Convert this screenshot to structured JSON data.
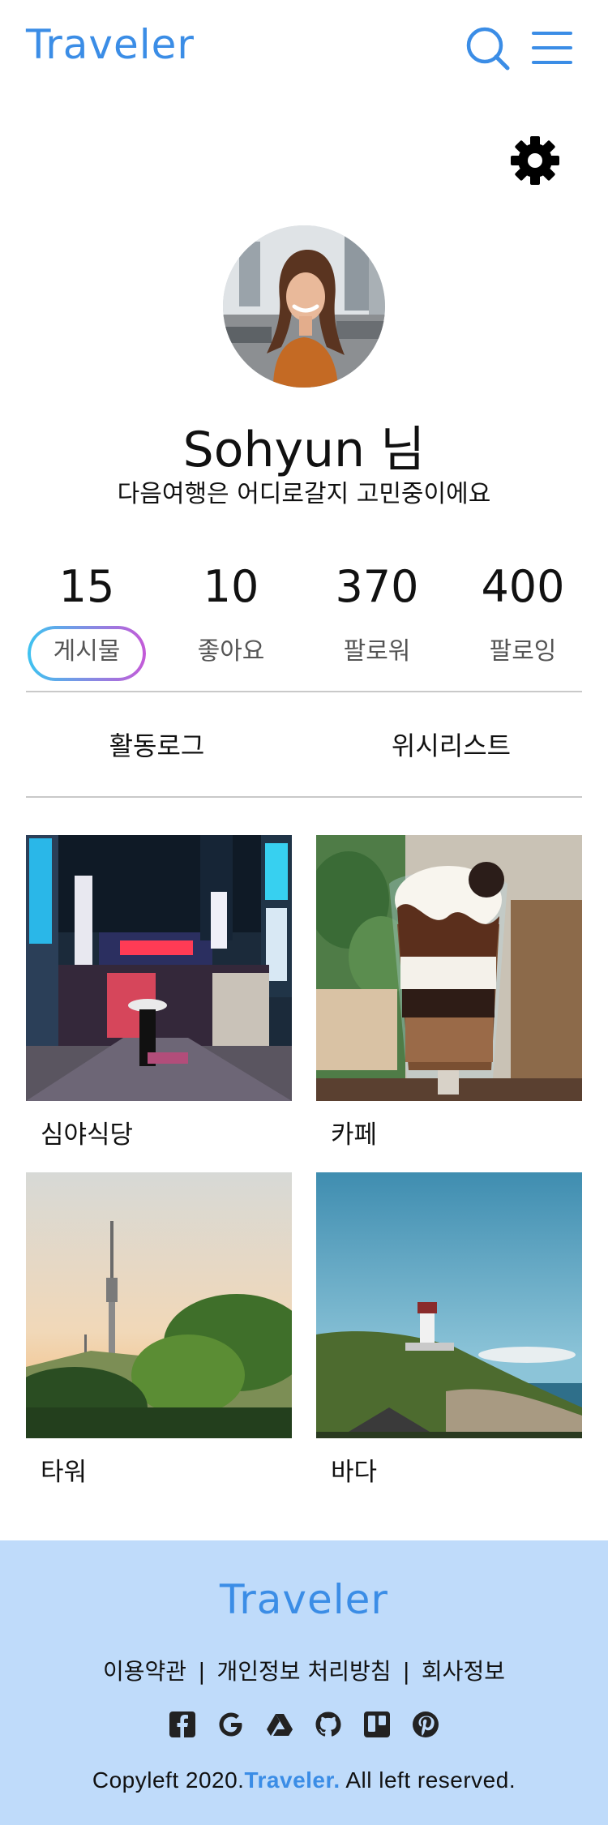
{
  "header": {
    "logo": "Traveler",
    "search_icon": "search-icon",
    "menu_icon": "hamburger-menu-icon",
    "settings_icon": "gear-icon"
  },
  "profile": {
    "name": "Sohyun 님",
    "bio": "다음여행은 어디로갈지 고민중이에요"
  },
  "stats": [
    {
      "value": "15",
      "label": "게시물",
      "active": true
    },
    {
      "value": "10",
      "label": "좋아요",
      "active": false
    },
    {
      "value": "370",
      "label": "팔로워",
      "active": false
    },
    {
      "value": "400",
      "label": "팔로잉",
      "active": false
    }
  ],
  "tabs": [
    {
      "label": "활동로그"
    },
    {
      "label": "위시리스트"
    }
  ],
  "posts": [
    {
      "label": "심야식당"
    },
    {
      "label": "카페"
    },
    {
      "label": "타워"
    },
    {
      "label": "바다"
    }
  ],
  "footer": {
    "logo": "Traveler",
    "links": [
      "이용약관",
      "개인정보 처리방침",
      "회사정보"
    ],
    "separator": "|",
    "social": [
      "facebook-icon",
      "google-icon",
      "google-drive-icon",
      "github-icon",
      "trello-icon",
      "pinterest-icon"
    ],
    "copyright_prefix": "Copyleft 2020.",
    "copyright_brand": "Traveler.",
    "copyright_suffix": " All left reserved."
  },
  "colors": {
    "brand": "#3b8de6",
    "footer_bg": "#bfdbfa",
    "active_gradient_start": "#3ec3f0",
    "active_gradient_end": "#c45ad8"
  }
}
